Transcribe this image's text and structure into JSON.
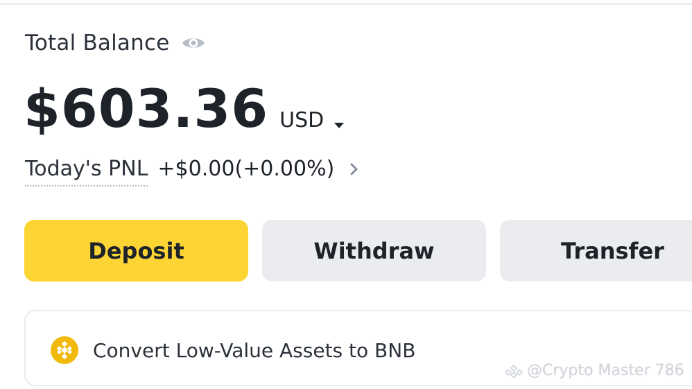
{
  "header": {
    "title": "Total Balance",
    "eye_icon": "eye-icon"
  },
  "balance": {
    "amount": "$603.36",
    "currency": "USD",
    "caret_icon": "caret-down-icon"
  },
  "pnl": {
    "label": "Today's PNL",
    "value": "+$0.00(+0.00%)",
    "chevron_icon": "chevron-right-icon"
  },
  "actions": {
    "deposit_label": "Deposit",
    "withdraw_label": "Withdraw",
    "transfer_label": "Transfer"
  },
  "convert": {
    "icon": "bnb-icon",
    "text": "Convert Low-Value Assets to BNB"
  },
  "watermark": {
    "text": "@Crypto Master 786"
  },
  "colors": {
    "accent_yellow": "#fcd535",
    "button_gray": "#eaecef",
    "text_primary": "#1e2329"
  }
}
